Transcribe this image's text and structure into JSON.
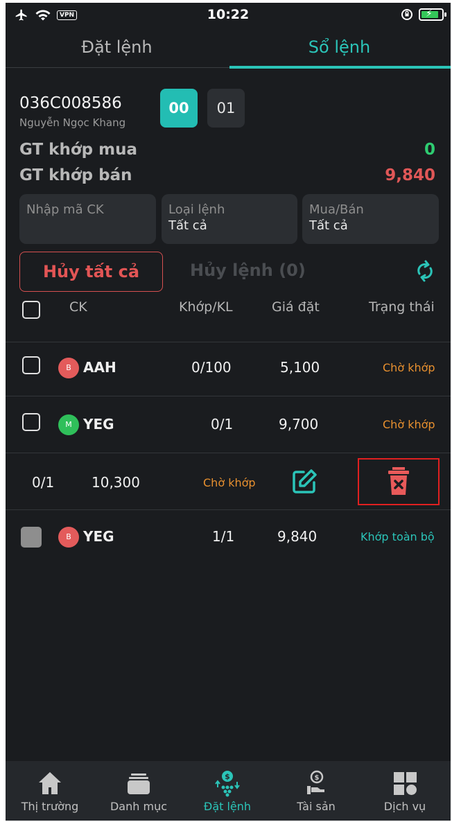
{
  "status_bar": {
    "time": "10:22",
    "vpn": "VPN"
  },
  "tabs": [
    {
      "label": "Đặt lệnh"
    },
    {
      "label": "Sổ lệnh"
    }
  ],
  "account": {
    "number": "036C008586",
    "name": "Nguyễn Ngọc Khang",
    "sub_accounts": [
      "00",
      "01"
    ],
    "active_sub": "00"
  },
  "summary": {
    "buy_label": "GT khớp mua",
    "buy_value": "0",
    "sell_label": "GT khớp bán",
    "sell_value": "9,840"
  },
  "filters": {
    "symbol_placeholder": "Nhập mã CK",
    "order_type_label": "Loại lệnh",
    "order_type_value": "Tất cả",
    "side_label": "Mua/Bán",
    "side_value": "Tất cả"
  },
  "actions": {
    "cancel_all": "Hủy tất cả",
    "cancel_selected": "Hủy lệnh (0)"
  },
  "table": {
    "headers": {
      "symbol": "CK",
      "matched": "Khớp/KL",
      "price": "Giá đặt",
      "status": "Trạng thái"
    },
    "rows": [
      {
        "side": "B",
        "symbol": "AAH",
        "matched": "0/100",
        "price": "5,100",
        "status": "Chờ khớp"
      },
      {
        "side": "M",
        "symbol": "YEG",
        "matched": "0/1",
        "price": "9,700",
        "status": "Chờ khớp"
      },
      {
        "matched": "0/1",
        "price": "10,300",
        "status": "Chờ khớp"
      },
      {
        "side": "B",
        "symbol": "YEG",
        "matched": "1/1",
        "price": "9,840",
        "status": "Khớp toàn bộ"
      }
    ]
  },
  "bottom_nav": [
    {
      "label": "Thị trường",
      "icon": "home-icon"
    },
    {
      "label": "Danh mục",
      "icon": "wallet-icon"
    },
    {
      "label": "Đặt lệnh",
      "icon": "order-icon"
    },
    {
      "label": "Tài sản",
      "icon": "asset-icon"
    },
    {
      "label": "Dịch vụ",
      "icon": "services-icon"
    }
  ],
  "colors": {
    "accent": "#2bc4b8",
    "buy": "#2ecc71",
    "sell": "#e05757",
    "pending": "#e8902f",
    "background": "#1a1c1f"
  }
}
